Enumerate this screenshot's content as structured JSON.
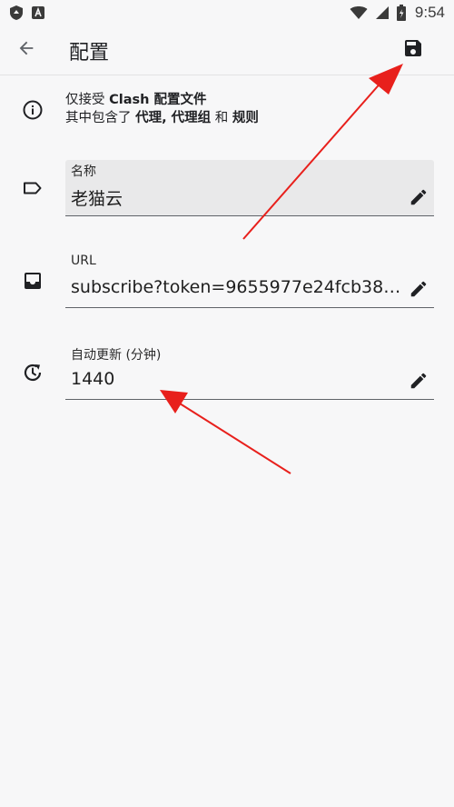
{
  "status_bar": {
    "time": "9:54",
    "left_icons": [
      "shield-icon",
      "app-a-icon"
    ],
    "right_icons": [
      "wifi-icon",
      "signal-icon",
      "battery-icon"
    ]
  },
  "toolbar": {
    "title": "配置",
    "back_icon": "arrow-back-icon",
    "save_icon": "save-icon"
  },
  "info": {
    "line1_prefix": "仅接受 ",
    "line1_bold": "Clash 配置文件",
    "line2_prefix": "其中包含了 ",
    "line2_bold_1": "代理, 代理组",
    "line2_mid": " 和 ",
    "line2_bold_2": "规则"
  },
  "fields": {
    "name": {
      "label": "名称",
      "value": "老猫云"
    },
    "url": {
      "label": "URL",
      "value": "subscribe?token=9655977e24fcb387…"
    },
    "interval": {
      "label": "自动更新 (分钟)",
      "value": "1440"
    }
  },
  "colors": {
    "background": "#f7f7f8",
    "field_fill": "#e9e9ea",
    "annotation_arrow": "#e8201c"
  }
}
